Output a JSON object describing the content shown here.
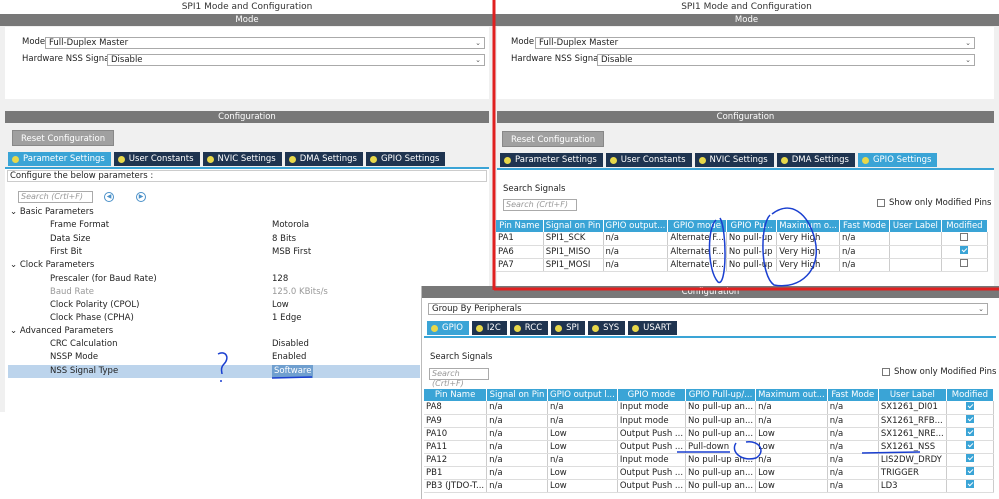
{
  "left": {
    "title": "SPI1 Mode and Configuration",
    "mode_bar": "Mode",
    "mode_label": "Mode",
    "mode_value": "Full-Duplex Master",
    "nss_label": "Hardware NSS Signal",
    "nss_value": "Disable",
    "config_bar": "Configuration",
    "reset_button": "Reset Configuration",
    "tabs": [
      "Parameter Settings",
      "User Constants",
      "NVIC Settings",
      "DMA Settings",
      "GPIO Settings"
    ],
    "configure_text": "Configure the below parameters :",
    "search_placeholder": "Search (Crtl+F)",
    "groups": [
      {
        "name": "Basic Parameters",
        "params": [
          [
            "Frame Format",
            "Motorola"
          ],
          [
            "Data Size",
            "8 Bits"
          ],
          [
            "First Bit",
            "MSB First"
          ]
        ]
      },
      {
        "name": "Clock Parameters",
        "params": [
          [
            "Prescaler (for Baud Rate)",
            "128"
          ],
          [
            "Baud Rate",
            "125.0 KBits/s"
          ],
          [
            "Clock Polarity (CPOL)",
            "Low"
          ],
          [
            "Clock Phase (CPHA)",
            "1 Edge"
          ]
        ]
      },
      {
        "name": "Advanced Parameters",
        "params": [
          [
            "CRC Calculation",
            "Disabled"
          ],
          [
            "NSSP Mode",
            "Enabled"
          ],
          [
            "NSS Signal Type",
            "Software"
          ]
        ]
      }
    ]
  },
  "right": {
    "title": "SPI1 Mode and Configuration",
    "mode_bar": "Mode",
    "mode_label": "Mode",
    "mode_value": "Full-Duplex Master",
    "nss_label": "Hardware NSS Signal",
    "nss_value": "Disable",
    "config_bar": "Configuration",
    "reset_button": "Reset Configuration",
    "tabs": [
      "Parameter Settings",
      "User Constants",
      "NVIC Settings",
      "DMA Settings",
      "GPIO Settings"
    ],
    "search_label": "Search Signals",
    "search_placeholder": "Search (Crtl+F)",
    "show_modified": "Show only Modified Pins",
    "columns": [
      "Pin Name",
      "Signal on Pin",
      "GPIO output...",
      "GPIO mode",
      "GPIO Pu...",
      "Maximum o...",
      "Fast Mode",
      "User Label",
      "Modified"
    ],
    "rows": [
      [
        "PA1",
        "SPI1_SCK",
        "n/a",
        "Alternate F...",
        "No pull-up",
        "Very High",
        "n/a",
        "",
        false
      ],
      [
        "PA6",
        "SPI1_MISO",
        "n/a",
        "Alternate F...",
        "No pull-up",
        "Very High",
        "n/a",
        "",
        true
      ],
      [
        "PA7",
        "SPI1_MOSI",
        "n/a",
        "Alternate F...",
        "No pull-up",
        "Very High",
        "n/a",
        "",
        false
      ]
    ]
  },
  "bottom": {
    "config_bar": "Configuration",
    "group_value": "Group By Peripherals",
    "tabs": [
      "GPIO",
      "I2C",
      "RCC",
      "SPI",
      "SYS",
      "USART"
    ],
    "search_label": "Search Signals",
    "search_placeholder": "Search (Crtl+F)",
    "show_modified": "Show only Modified Pins",
    "columns": [
      "Pin Name",
      "Signal on Pin",
      "GPIO output l...",
      "GPIO mode",
      "GPIO Pull-up/...",
      "Maximum out...",
      "Fast Mode",
      "User Label",
      "Modified"
    ],
    "rows": [
      [
        "PA8",
        "n/a",
        "n/a",
        "Input mode",
        "No pull-up an...",
        "n/a",
        "n/a",
        "SX1261_DI01",
        true
      ],
      [
        "PA9",
        "n/a",
        "n/a",
        "Input mode",
        "No pull-up an...",
        "n/a",
        "n/a",
        "SX1261_RFB...",
        true
      ],
      [
        "PA10",
        "n/a",
        "Low",
        "Output Push ...",
        "No pull-up an...",
        "Low",
        "n/a",
        "SX1261_NRE...",
        true
      ],
      [
        "PA11",
        "n/a",
        "Low",
        "Output Push ...",
        "Pull-down",
        "Low",
        "n/a",
        "SX1261_NSS",
        true
      ],
      [
        "PA12",
        "n/a",
        "n/a",
        "Input mode",
        "No pull-up an...",
        "n/a",
        "n/a",
        "LIS2DW_DRDY",
        true
      ],
      [
        "PB1",
        "n/a",
        "Low",
        "Output Push ...",
        "No pull-up an...",
        "Low",
        "n/a",
        "TRIGGER",
        true
      ],
      [
        "PB3 (JTDO-T...",
        "n/a",
        "Low",
        "Output Push ...",
        "No pull-up an...",
        "Low",
        "n/a",
        "LD3",
        true
      ]
    ]
  },
  "colors": {
    "tab_dark": "#1f3450",
    "tab_active": "#3aa4d6",
    "red_annotation": "#e02020",
    "ink": "#1a3fd0"
  }
}
